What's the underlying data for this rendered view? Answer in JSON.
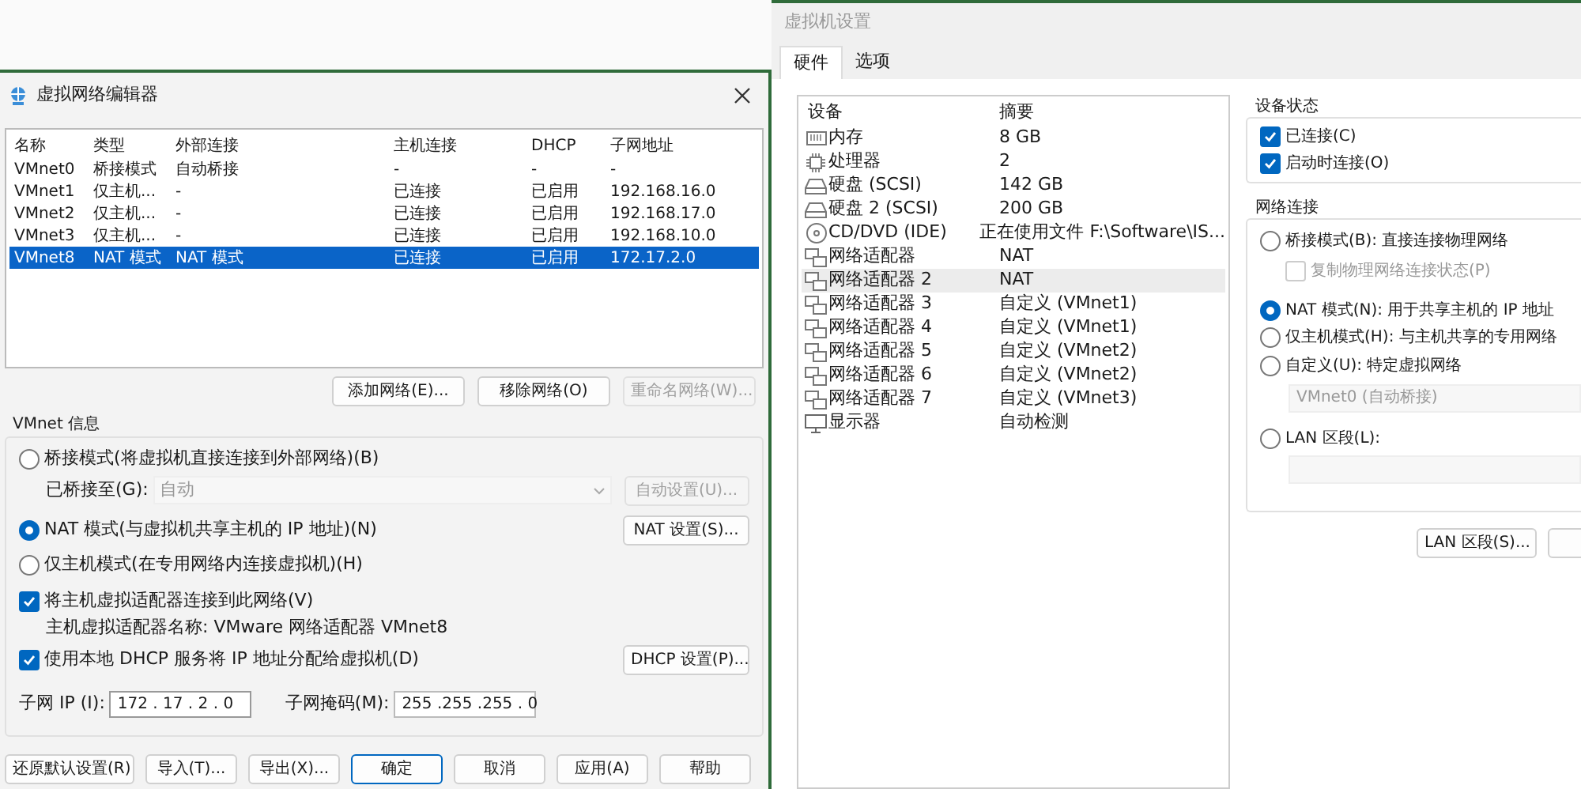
{
  "network_editor": {
    "title": "虚拟网络编辑器",
    "table": {
      "columns": [
        "名称",
        "类型",
        "外部连接",
        "主机连接",
        "DHCP",
        "子网地址"
      ],
      "rows": [
        {
          "cells": [
            "VMnet0",
            "桥接模式",
            "自动桥接",
            "-",
            "-",
            "-"
          ],
          "selected": false
        },
        {
          "cells": [
            "VMnet1",
            "仅主机...",
            "-",
            "已连接",
            "已启用",
            "192.168.16.0"
          ],
          "selected": false
        },
        {
          "cells": [
            "VMnet2",
            "仅主机...",
            "-",
            "已连接",
            "已启用",
            "192.168.17.0"
          ],
          "selected": false
        },
        {
          "cells": [
            "VMnet3",
            "仅主机...",
            "-",
            "已连接",
            "已启用",
            "192.168.10.0"
          ],
          "selected": false
        },
        {
          "cells": [
            "VMnet8",
            "NAT 模式",
            "NAT 模式",
            "已连接",
            "已启用",
            "172.17.2.0"
          ],
          "selected": true
        }
      ]
    },
    "table_buttons": [
      {
        "label": "添加网络(E)...",
        "disabled": false
      },
      {
        "label": "移除网络(O)",
        "disabled": false
      },
      {
        "label": "重命名网络(W)...",
        "disabled": true
      }
    ],
    "vmnet_info": {
      "title": "VMnet 信息",
      "bridged": {
        "label": "桥接模式(将虚拟机直接连接到外部网络)(B)",
        "selected": false
      },
      "bridged_to": {
        "label": "已桥接至(G):",
        "value": "自动",
        "disabled": true
      },
      "auto_settings_button": {
        "label": "自动设置(U)...",
        "disabled": true
      },
      "nat": {
        "label": "NAT 模式(与虚拟机共享主机的 IP 地址)(N)",
        "selected": true
      },
      "nat_settings_button": {
        "label": "NAT 设置(S)..."
      },
      "host_only": {
        "label": "仅主机模式(在专用网络内连接虚拟机)(H)",
        "selected": false
      },
      "connect_adapter": {
        "label": "将主机虚拟适配器连接到此网络(V)",
        "checked": true
      },
      "adapter_name": "主机虚拟适配器名称: VMware 网络适配器 VMnet8",
      "use_dhcp": {
        "label": "使用本地 DHCP 服务将 IP 地址分配给虚拟机(D)",
        "checked": true
      },
      "dhcp_settings_button": {
        "label": "DHCP 设置(P)..."
      },
      "subnet_ip": {
        "label": "子网 IP (I):",
        "value": "172 . 17 . 2 . 0"
      },
      "subnet_mask": {
        "label": "子网掩码(M):",
        "value": "255 .255 .255 . 0"
      }
    },
    "footer_buttons": [
      {
        "label": "还原默认设置(R)",
        "default": false
      },
      {
        "label": "导入(T)...",
        "default": false
      },
      {
        "label": "导出(X)...",
        "default": false
      },
      {
        "label": "确定",
        "default": true
      },
      {
        "label": "取消",
        "default": false
      },
      {
        "label": "应用(A)",
        "default": false
      },
      {
        "label": "帮助",
        "default": false
      }
    ]
  },
  "vm_settings": {
    "title": "虚拟机设置",
    "tabs": [
      {
        "label": "硬件",
        "selected": true
      },
      {
        "label": "选项",
        "selected": false
      }
    ],
    "device_list": {
      "columns": [
        "设备",
        "摘要"
      ],
      "rows": [
        {
          "kind": "memory",
          "device": "内存",
          "summary": "8 GB",
          "selected": false
        },
        {
          "kind": "cpu",
          "device": "处理器",
          "summary": "2",
          "selected": false
        },
        {
          "kind": "disk",
          "device": "硬盘 (SCSI)",
          "summary": "142 GB",
          "selected": false
        },
        {
          "kind": "disk",
          "device": "硬盘 2 (SCSI)",
          "summary": "200 GB",
          "selected": false
        },
        {
          "kind": "cd",
          "device": "CD/DVD (IDE)",
          "summary": "正在使用文件 F:\\Software\\IS...",
          "selected": false
        },
        {
          "kind": "network",
          "device": "网络适配器",
          "summary": "NAT",
          "selected": false
        },
        {
          "kind": "network",
          "device": "网络适配器 2",
          "summary": "NAT",
          "selected": true
        },
        {
          "kind": "network",
          "device": "网络适配器 3",
          "summary": "自定义 (VMnet1)",
          "selected": false
        },
        {
          "kind": "network",
          "device": "网络适配器 4",
          "summary": "自定义 (VMnet1)",
          "selected": false
        },
        {
          "kind": "network",
          "device": "网络适配器 5",
          "summary": "自定义 (VMnet2)",
          "selected": false
        },
        {
          "kind": "network",
          "device": "网络适配器 6",
          "summary": "自定义 (VMnet2)",
          "selected": false
        },
        {
          "kind": "network",
          "device": "网络适配器 7",
          "summary": "自定义 (VMnet3)",
          "selected": false
        },
        {
          "kind": "display",
          "device": "显示器",
          "summary": "自动检测",
          "selected": false
        }
      ]
    },
    "device_status": {
      "title": "设备状态",
      "options": [
        {
          "label": "已连接(C)",
          "checked": true
        },
        {
          "label": "启动时连接(O)",
          "checked": true
        }
      ]
    },
    "network_connection": {
      "title": "网络连接",
      "bridged": {
        "label": "桥接模式(B): 直接连接物理网络",
        "selected": false
      },
      "replicate_state": {
        "label": "复制物理网络连接状态(P)",
        "checked": false,
        "disabled": true
      },
      "nat": {
        "label": "NAT 模式(N): 用于共享主机的 IP 地址",
        "selected": true
      },
      "host_only": {
        "label": "仅主机模式(H): 与主机共享的专用网络",
        "selected": false
      },
      "custom": {
        "label": "自定义(U): 特定虚拟网络",
        "selected": false
      },
      "custom_network": {
        "value": "VMnet0 (自动桥接)",
        "disabled": true
      },
      "lan_segment": {
        "label": "LAN 区段(L):",
        "selected": false
      }
    },
    "lan_segments_button": {
      "label": "LAN 区段(S)..."
    }
  }
}
